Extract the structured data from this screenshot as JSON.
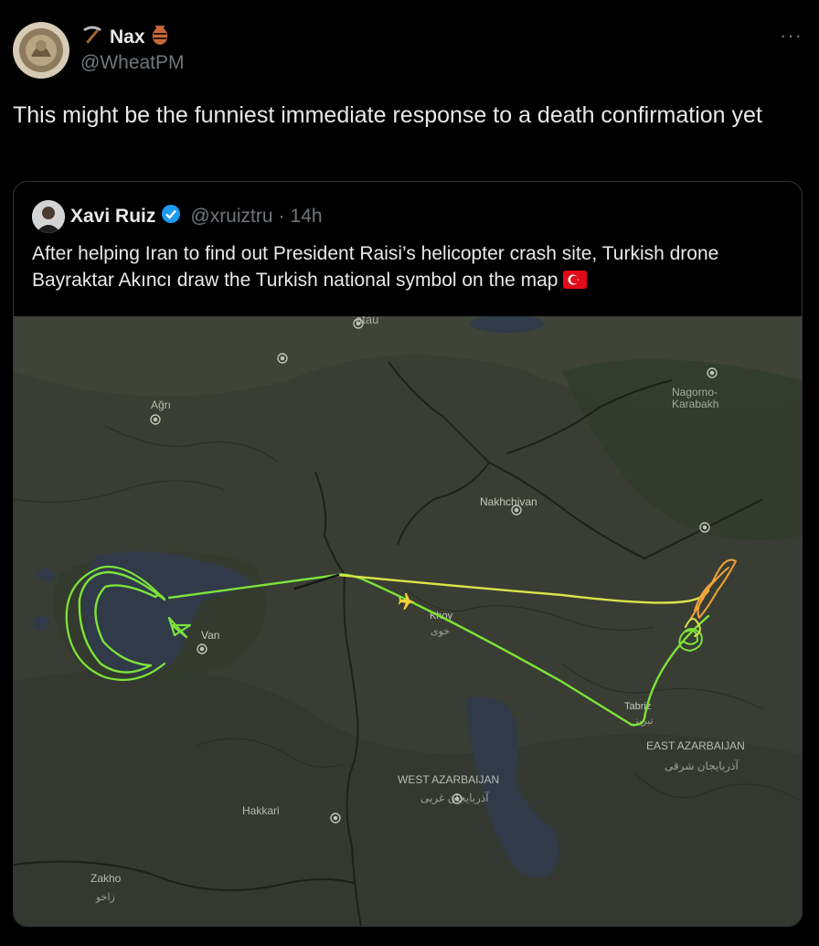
{
  "tweet": {
    "display_name": "Nax",
    "handle": "@WheatPM",
    "more_label": "···",
    "text": "This might be the funniest immediate response to a death confirmation yet"
  },
  "quoted": {
    "display_name": "Xavi Ruiz",
    "handle": "@xruiztru",
    "separator": "·",
    "time": "14h",
    "text": "After helping Iran to find out President Raisi’s helicopter crash site, Turkish drone Bayraktar Akıncı draw the Turkish national symbol on the map"
  },
  "map": {
    "labels": {
      "agri": "Ağrı",
      "nakhchivan": "Nakhchivan",
      "nagorno": "Nagorno-",
      "karabakh": "Karabakh",
      "van": "Van",
      "khoy": "Khoy",
      "khoy_fa": "خوی",
      "tabriz": "Tabriz",
      "tabriz_fa": "تبریز",
      "east_az": "EAST AZARBAIJAN",
      "east_az_fa": "آذربایجان شرقی",
      "west_az": "WEST AZARBAIJAN",
      "west_az_fa": "آذربایجان غربی",
      "hakkari": "Hakkari",
      "zakho": "Zakho",
      "zakho_ar": "زاخو",
      "top_cut": "atau"
    },
    "colors": {
      "land": "#3a3d33",
      "water": "#303a48",
      "track_green": "#7ce33a",
      "track_yellow": "#d9e44a",
      "track_orange": "#f0a23a",
      "plane": "#f2d13b"
    }
  }
}
